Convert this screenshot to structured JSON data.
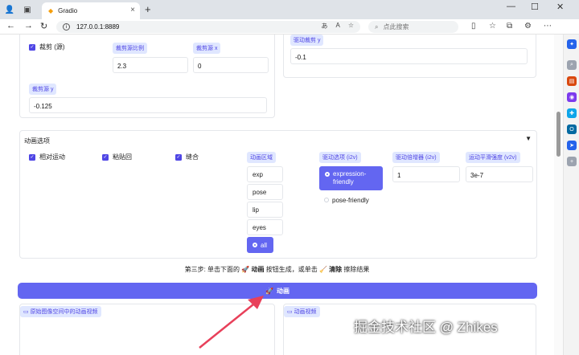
{
  "browser": {
    "tab_title": "Gradio",
    "url": "127.0.0.1:8889",
    "search_placeholder": "点此搜索"
  },
  "crop_section": {
    "crop_checkbox": "裁剪 (源)",
    "ratio_label": "裁剪源比例",
    "ratio_value": "2.3",
    "x_label": "裁剪源 x",
    "x_value": "0",
    "y_label": "裁剪源 y",
    "y_value": "-0.125",
    "driving_y_label": "驱动裁剪 y",
    "driving_y_value": "-0.1"
  },
  "animation_options": {
    "title": "动画选项",
    "checkboxes": [
      "相对运动",
      "粘贴回",
      "缝合"
    ],
    "region_label": "动画区域",
    "regions": [
      "exp",
      "pose",
      "lip",
      "eyes",
      "all"
    ],
    "selected_region": "all",
    "driving_option_label": "驱动选项 (i2v)",
    "driving_options": [
      "expression-friendly",
      "pose-friendly"
    ],
    "selected_driving_option": "expression-friendly",
    "multiplier_label": "驱动倍增器 (i2v)",
    "multiplier_value": "1",
    "smooth_label": "运动平滑强度 (v2v)",
    "smooth_value": "3e-7"
  },
  "step3": {
    "prefix": "第三步: 单击下面的",
    "rocket_icon": "🚀",
    "animate": "动画",
    "middle": "按钮生成，或单击",
    "broom_icon": "🧹",
    "clear": "清除",
    "suffix": "擦除结果"
  },
  "animate_button": "动画",
  "outputs": {
    "left_label": "原始图像空间中的动画视频",
    "right_label": "动画视频"
  },
  "watermark": "掘金技术社区 @ Zhikes",
  "colors": {
    "accent": "#6366f1",
    "label_bg": "#e0e7ff",
    "arrow": "#e8405a"
  }
}
